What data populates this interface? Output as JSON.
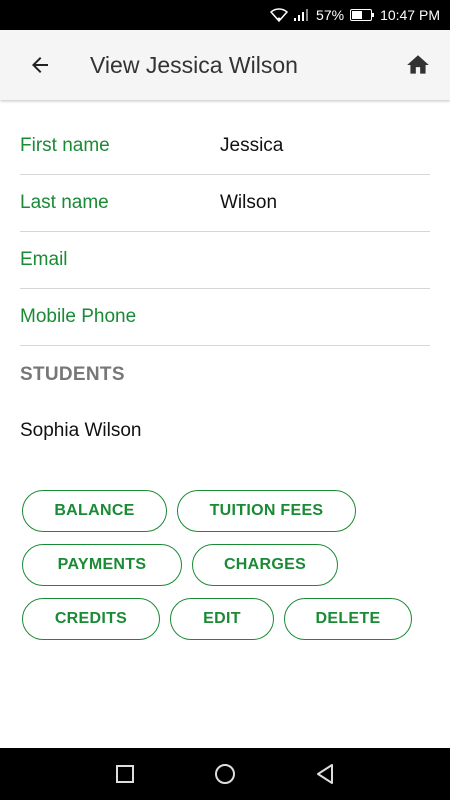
{
  "status_bar": {
    "battery": "57%",
    "time": "10:47 PM"
  },
  "app_bar": {
    "title": "View Jessica Wilson",
    "back_icon": "arrow-left-icon",
    "home_icon": "home-icon"
  },
  "fields": [
    {
      "label": "First name",
      "value": "Jessica"
    },
    {
      "label": "Last name",
      "value": "Wilson"
    },
    {
      "label": "Email",
      "value": ""
    },
    {
      "label": "Mobile Phone",
      "value": ""
    }
  ],
  "students": {
    "title": "STUDENTS",
    "items": [
      "Sophia Wilson"
    ]
  },
  "actions": {
    "balance": "BALANCE",
    "tuition_fees": "TUITION FEES",
    "payments": "PAYMENTS",
    "charges": "CHARGES",
    "credits": "CREDITS",
    "edit": "EDIT",
    "delete": "DELETE"
  },
  "colors": {
    "accent": "#1a8a35",
    "label": "#777777"
  }
}
